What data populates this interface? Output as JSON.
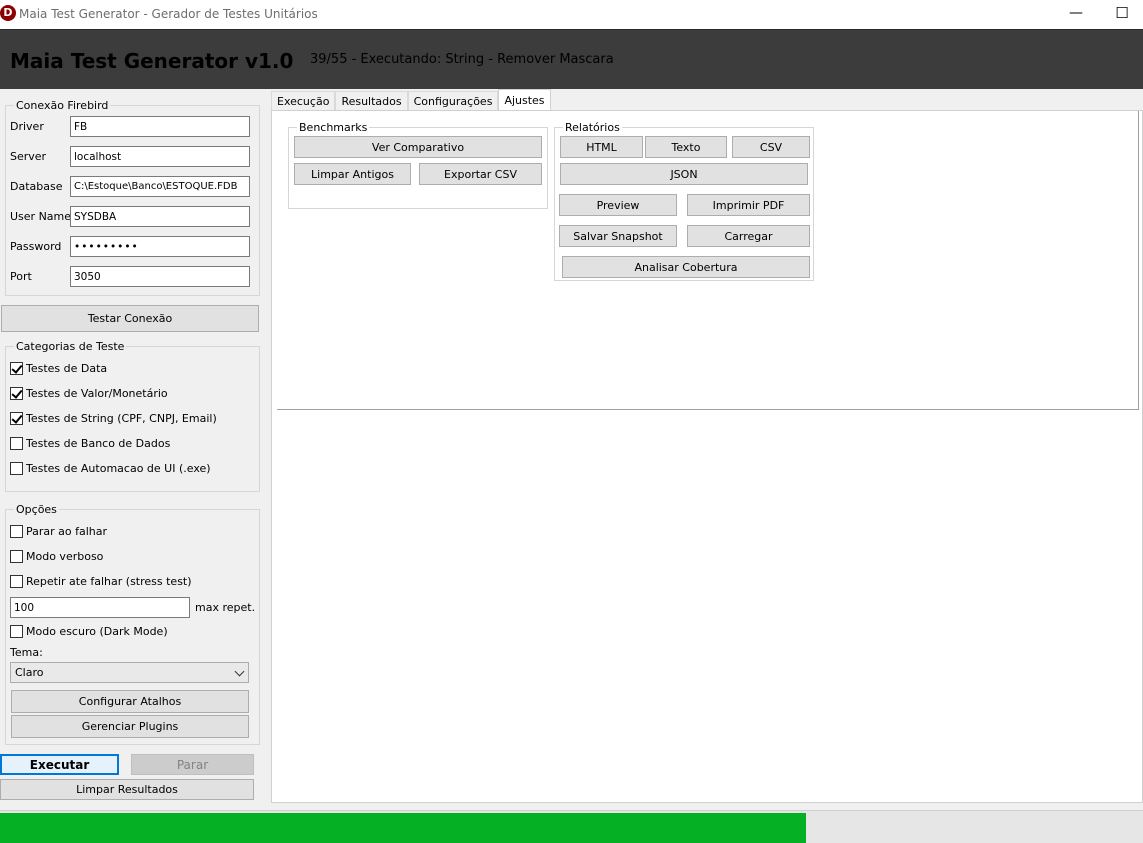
{
  "window": {
    "icon_letter": "D",
    "title": "Maia Test Generator - Gerador de Testes Unitários",
    "minimize": "—",
    "maximize": "☐"
  },
  "header": {
    "app_title": "Maia Test Generator v1.0",
    "status": "39/55 - Executando: String - Remover Mascara"
  },
  "connection": {
    "group_title": "Conexão Firebird",
    "fields": [
      {
        "label": "Driver",
        "value": "FB"
      },
      {
        "label": "Server",
        "value": "localhost"
      },
      {
        "label": "Database",
        "value": "C:\\Estoque\\Banco\\ESTOQUE.FDB"
      },
      {
        "label": "User Name",
        "value": "SYSDBA"
      },
      {
        "label": "Password",
        "value": "•••••••••"
      },
      {
        "label": "Port",
        "value": "3050"
      }
    ],
    "test_button": "Testar Conexão"
  },
  "categories": {
    "group_title": "Categorias de Teste",
    "items": [
      {
        "label": "Testes de Data",
        "checked": true
      },
      {
        "label": "Testes de Valor/Monetário",
        "checked": true
      },
      {
        "label": "Testes de String (CPF, CNPJ, Email)",
        "checked": true
      },
      {
        "label": "Testes de Banco de Dados",
        "checked": false
      },
      {
        "label": "Testes de Automacao de UI (.exe)",
        "checked": false
      }
    ]
  },
  "options": {
    "group_title": "Opções",
    "stop_on_fail": "Parar ao falhar",
    "verbose": "Modo verboso",
    "repeat": "Repetir ate falhar (stress test)",
    "max_repeat_value": "100",
    "max_repeat_label": "max repet.",
    "dark_mode": "Modo escuro (Dark Mode)",
    "theme_label": "Tema:",
    "theme_value": "Claro",
    "shortcuts_button": "Configurar Atalhos",
    "plugins_button": "Gerenciar Plugins"
  },
  "actions": {
    "run": "Executar",
    "stop": "Parar",
    "clear": "Limpar Resultados"
  },
  "tabs": [
    {
      "label": "Execução",
      "active": false
    },
    {
      "label": "Resultados",
      "active": false
    },
    {
      "label": "Configurações",
      "active": false
    },
    {
      "label": "Ajustes",
      "active": true
    }
  ],
  "benchmarks": {
    "group_title": "Benchmarks",
    "compare": "Ver Comparativo",
    "clean_old": "Limpar Antigos",
    "export_csv": "Exportar CSV"
  },
  "reports": {
    "group_title": "Relatórios",
    "html": "HTML",
    "text": "Texto",
    "csv": "CSV",
    "json": "JSON",
    "preview": "Preview",
    "print_pdf": "Imprimir PDF",
    "save_snapshot": "Salvar Snapshot",
    "load": "Carregar",
    "coverage": "Analisar Cobertura"
  },
  "progress": {
    "percent": 70.5,
    "color": "#06b025"
  }
}
